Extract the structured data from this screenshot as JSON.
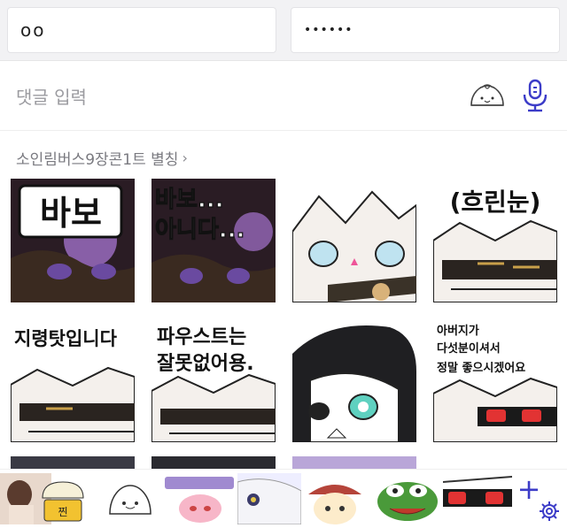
{
  "inputs": {
    "left_value": "oo",
    "right_value": "••••••"
  },
  "comment": {
    "placeholder": "댓글 입력"
  },
  "icons": {
    "emoji": "dumpling-emoji-icon",
    "mic": "microphone-icon",
    "plus": "plus-icon",
    "settings": "gear-icon"
  },
  "sticker_pack": {
    "title": "소인림버스9장콘1트 별칭",
    "chevron": "›",
    "stickers": [
      {
        "id": "s1",
        "text": "바보"
      },
      {
        "id": "s2",
        "text_line1": "바보...",
        "text_line2": "아니다..."
      },
      {
        "id": "s3",
        "text": ""
      },
      {
        "id": "s4",
        "text": "(흐린눈)"
      },
      {
        "id": "s5",
        "text": "지령탓입니다"
      },
      {
        "id": "s6",
        "text_line1": "파우스트는",
        "text_line2": "잘못없어용."
      },
      {
        "id": "s7",
        "text": ""
      },
      {
        "id": "s8",
        "text_line1": "아버지가",
        "text_line2": "다섯분이셔서",
        "text_line3": "정말 좋으시겠어요"
      }
    ]
  },
  "tray": {
    "items": [
      "tray-sticker-1",
      "tray-sticker-2",
      "tray-sticker-3",
      "tray-sticker-4",
      "tray-sticker-5",
      "tray-sticker-6",
      "tray-sticker-7",
      "tray-sticker-8"
    ],
    "label_2": "찐"
  },
  "colors": {
    "accent": "#3c3cc8",
    "placeholder": "#9b9ba0"
  }
}
